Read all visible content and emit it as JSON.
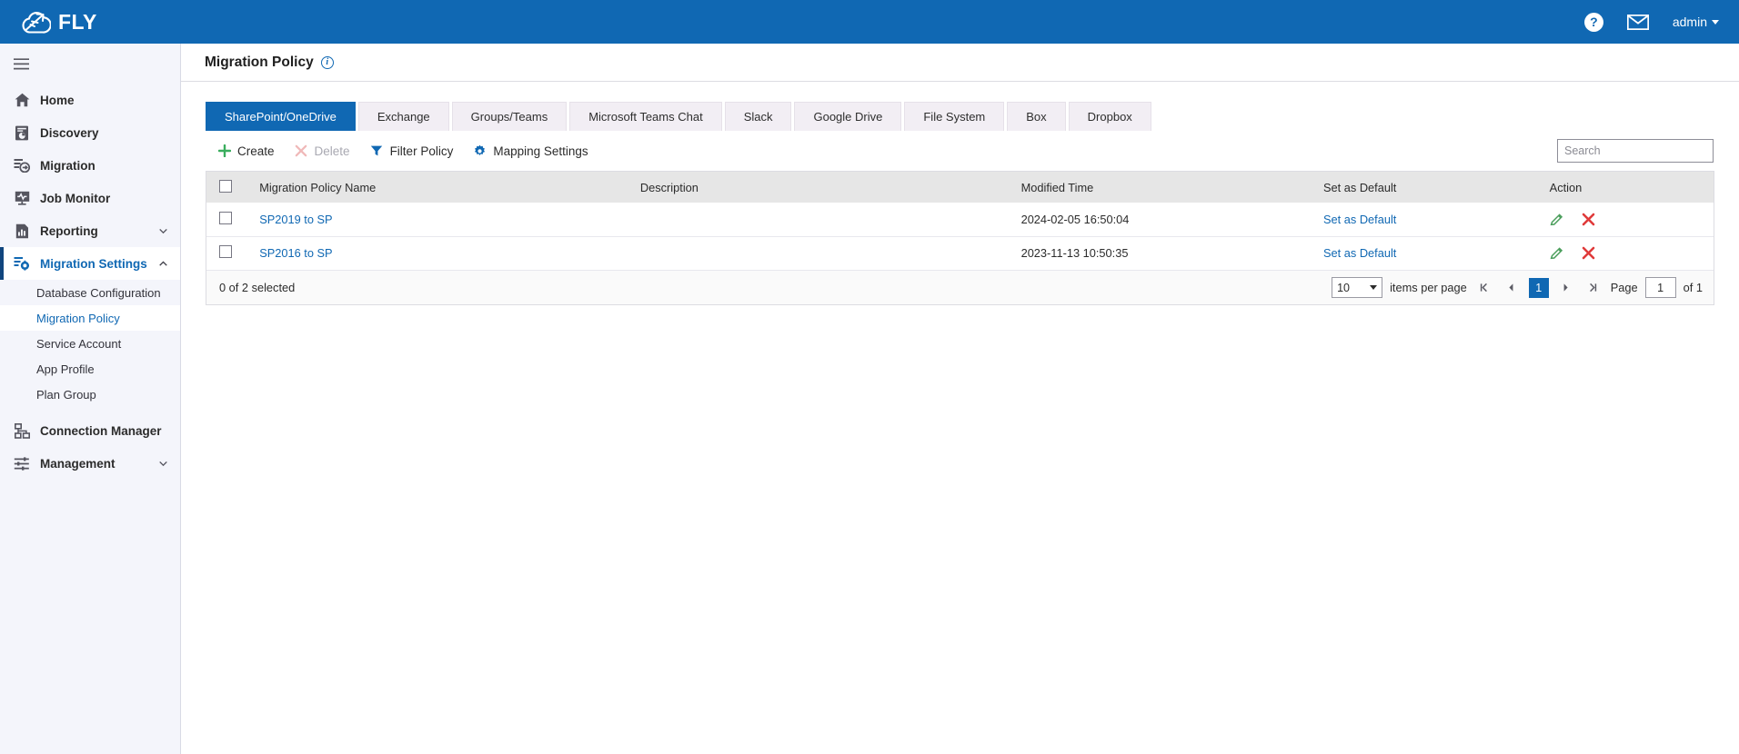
{
  "topbar": {
    "brand": "FLY",
    "help_icon": "help-icon",
    "mail_icon": "mail-icon",
    "user": "admin"
  },
  "sidebar": {
    "hamburger": "hamburger-icon",
    "items": [
      {
        "label": "Home",
        "icon": "home-icon",
        "active": false,
        "expandable": false
      },
      {
        "label": "Discovery",
        "icon": "discovery-icon",
        "active": false,
        "expandable": false
      },
      {
        "label": "Migration",
        "icon": "migration-icon",
        "active": false,
        "expandable": false
      },
      {
        "label": "Job Monitor",
        "icon": "job-monitor-icon",
        "active": false,
        "expandable": false
      },
      {
        "label": "Reporting",
        "icon": "reporting-icon",
        "active": false,
        "expandable": true
      },
      {
        "label": "Migration Settings",
        "icon": "migration-settings-icon",
        "active": true,
        "expandable": true
      },
      {
        "label": "Connection Manager",
        "icon": "connection-manager-icon",
        "active": false,
        "expandable": false
      },
      {
        "label": "Management",
        "icon": "management-icon",
        "active": false,
        "expandable": true
      }
    ],
    "sub_items": [
      {
        "label": "Database Configuration",
        "active": false
      },
      {
        "label": "Migration Policy",
        "active": true
      },
      {
        "label": "Service Account",
        "active": false
      },
      {
        "label": "App Profile",
        "active": false
      },
      {
        "label": "Plan Group",
        "active": false
      }
    ]
  },
  "page": {
    "title": "Migration Policy",
    "info_icon": "info-icon"
  },
  "tabs": [
    {
      "label": "SharePoint/OneDrive",
      "active": true
    },
    {
      "label": "Exchange",
      "active": false
    },
    {
      "label": "Groups/Teams",
      "active": false
    },
    {
      "label": "Microsoft Teams Chat",
      "active": false
    },
    {
      "label": "Slack",
      "active": false
    },
    {
      "label": "Google Drive",
      "active": false
    },
    {
      "label": "File System",
      "active": false
    },
    {
      "label": "Box",
      "active": false
    },
    {
      "label": "Dropbox",
      "active": false
    }
  ],
  "toolbar": {
    "create_label": "Create",
    "delete_label": "Delete",
    "filter_label": "Filter Policy",
    "mapping_label": "Mapping Settings"
  },
  "search": {
    "placeholder": "Search",
    "value": ""
  },
  "table": {
    "columns": [
      "Migration Policy Name",
      "Description",
      "Modified Time",
      "Set as Default",
      "Action"
    ],
    "rows": [
      {
        "name": "SP2019 to SP",
        "description": "",
        "modified_time": "2024-02-05 16:50:04",
        "set_as_default": "Set as Default",
        "edit_icon": "edit-pencil-icon",
        "delete_icon": "delete-x-icon"
      },
      {
        "name": "SP2016 to SP",
        "description": "",
        "modified_time": "2023-11-13 10:50:35",
        "set_as_default": "Set as Default",
        "edit_icon": "edit-pencil-icon",
        "delete_icon": "delete-x-icon"
      }
    ]
  },
  "footer": {
    "selection": "0 of 2 selected",
    "items_per_page_value": "10",
    "items_per_page_label": "items per page",
    "page_label": "Page",
    "page_value": "1",
    "of_label": "of 1",
    "current_page": "1"
  },
  "colors": {
    "brand_blue": "#1068b3",
    "accent_dark_blue": "#10457e",
    "sidebar_bg": "#f4f5fb",
    "tab_inactive": "#f2eef4",
    "table_header": "#e6e6e6",
    "link": "#1068b3",
    "create_green": "#3aad5e",
    "delete_red": "#e03a3a",
    "delete_disabled": "#f0b9b9"
  }
}
